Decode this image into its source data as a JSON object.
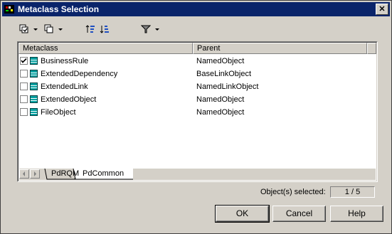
{
  "window": {
    "title": "Metaclass Selection",
    "close_label": "✕"
  },
  "toolbar": {
    "items": [
      {
        "icon": "select-all-icon"
      },
      {
        "icon": "deselect-all-icon"
      },
      {
        "icon": "sort-ascending-icon"
      },
      {
        "icon": "sort-descending-icon"
      },
      {
        "icon": "filter-icon"
      }
    ]
  },
  "grid": {
    "columns": [
      "Metaclass",
      "Parent"
    ],
    "rows": [
      {
        "name": "BusinessRule",
        "parent": "NamedObject",
        "checked": true
      },
      {
        "name": "ExtendedDependency",
        "parent": "BaseLinkObject",
        "checked": false
      },
      {
        "name": "ExtendedLink",
        "parent": "NamedLinkObject",
        "checked": false
      },
      {
        "name": "ExtendedObject",
        "parent": "NamedObject",
        "checked": false
      },
      {
        "name": "FileObject",
        "parent": "NamedObject",
        "checked": false
      }
    ]
  },
  "tabs": [
    {
      "label": "PdRQM",
      "active": false
    },
    {
      "label": "PdCommon",
      "active": true
    }
  ],
  "status": {
    "label": "Object(s) selected:",
    "value": "1 / 5"
  },
  "buttons": {
    "ok": "OK",
    "cancel": "Cancel",
    "help": "Help"
  },
  "colors": {
    "title_bar": "#0a246a",
    "dialog_bg": "#d4d0c8",
    "metaclass_icon": "#00a0a0"
  }
}
